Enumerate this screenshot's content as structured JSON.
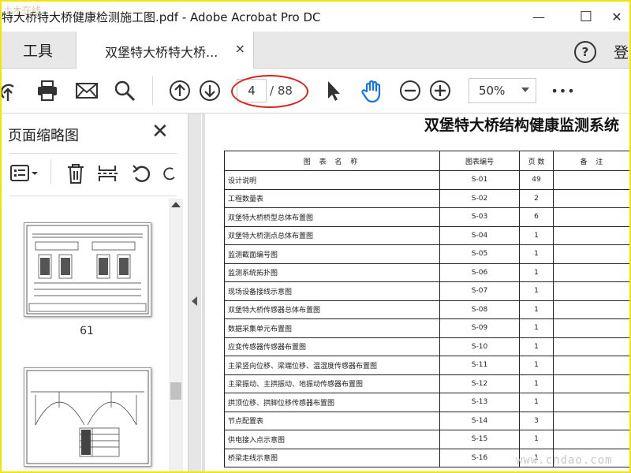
{
  "window": {
    "title": "特大桥特大桥健康检测施工图.pdf - Adobe Acrobat Pro DC",
    "minimize_glyph": "—",
    "maximize_glyph": "☐",
    "close_glyph": "✕"
  },
  "tabs": {
    "tools": "工具",
    "document": "双堡特大桥特大桥...",
    "close_glyph": "×"
  },
  "header": {
    "help": "?",
    "signin": "登"
  },
  "toolbar": {
    "current_page": "4",
    "total_pages": "/ 88",
    "zoom": "50%",
    "more": "•••",
    "icons": [
      "upload-icon",
      "print-icon",
      "email-icon",
      "search-icon",
      "page-up-icon",
      "page-down-icon",
      "select-arrow-icon",
      "hand-icon",
      "zoom-out-icon",
      "zoom-in-icon",
      "more-icon"
    ]
  },
  "sidebar": {
    "title": "页面缩略图",
    "close_glyph": "✕",
    "thumbnails": [
      {
        "label": "61"
      },
      {
        "label": ""
      }
    ]
  },
  "document": {
    "title": "双堡特大桥结构健康监测系统",
    "headers": [
      "图 表 名 称",
      "图表编号",
      "页 数",
      "备  注"
    ],
    "rows": [
      [
        "设计说明",
        "S-01",
        "49",
        ""
      ],
      [
        "工程数量表",
        "S-02",
        "2",
        ""
      ],
      [
        "双堡特大桥桥型总体布置图",
        "S-03",
        "6",
        ""
      ],
      [
        "双堡特大桥测点总体布置图",
        "S-04",
        "1",
        ""
      ],
      [
        "监测截面编号图",
        "S-05",
        "1",
        ""
      ],
      [
        "监测系统拓扑图",
        "S-06",
        "1",
        ""
      ],
      [
        "现场设备接线示意图",
        "S-07",
        "1",
        ""
      ],
      [
        "双堡特大桥传感器总体布置图",
        "S-08",
        "1",
        ""
      ],
      [
        "数据采集单元布置图",
        "S-09",
        "1",
        ""
      ],
      [
        "应变传感器传感器布置图",
        "S-10",
        "1",
        ""
      ],
      [
        "主梁竖向位移、梁端位移、温湿度传感器布置图",
        "S-11",
        "1",
        ""
      ],
      [
        "主梁振动、主拱振动、地振动传感器布置图",
        "S-12",
        "1",
        ""
      ],
      [
        "拱顶位移、拱脚位移传感器布置图",
        "S-13",
        "1",
        ""
      ],
      [
        "节点配置表",
        "S-14",
        "3",
        ""
      ],
      [
        "供电接入点示意图",
        "S-15",
        "1",
        ""
      ],
      [
        "桥梁走线示意图",
        "S-16",
        "1",
        ""
      ]
    ]
  },
  "watermark": {
    "bottom": "www.cndao.com",
    "top": "土木在线"
  },
  "colors": {
    "frame": "#f2e500",
    "annotation_oval": "#d8241f",
    "hand_tool": "#1473e6"
  }
}
